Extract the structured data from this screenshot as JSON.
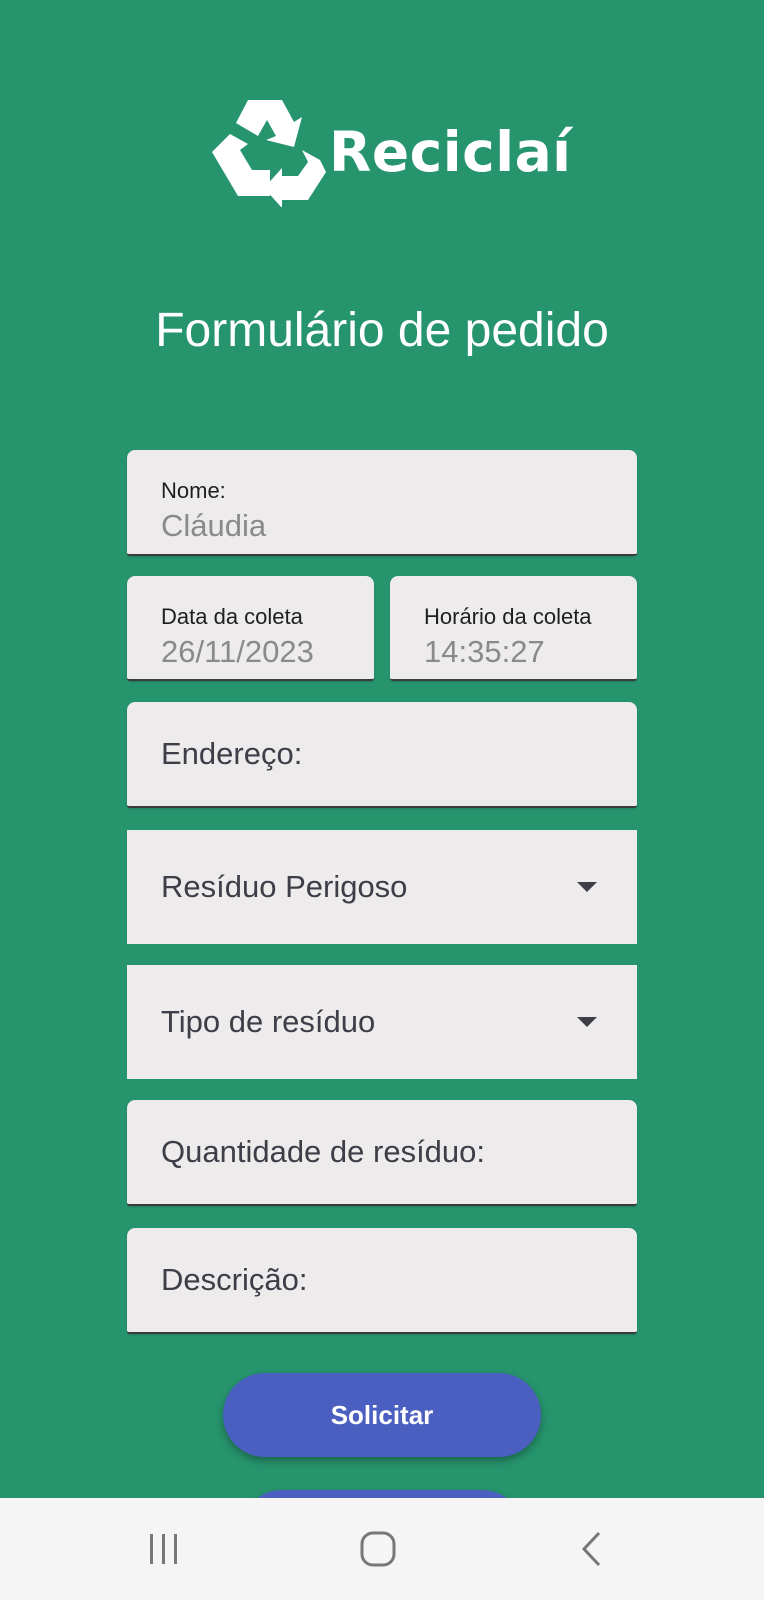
{
  "app": {
    "brand": "Reciclaí"
  },
  "form": {
    "title": "Formulário de pedido",
    "nome": {
      "label": "Nome:",
      "value": "Cláudia"
    },
    "data": {
      "label": "Data da coleta",
      "value": "26/11/2023"
    },
    "horario": {
      "label": "Horário da coleta",
      "value": "14:35:27"
    },
    "endereco": {
      "label": "Endereço:"
    },
    "residuo_perigoso": {
      "label": "Resíduo Perigoso"
    },
    "tipo_residuo": {
      "label": "Tipo de resíduo"
    },
    "quantidade": {
      "label": "Quantidade de resíduo:"
    },
    "descricao": {
      "label": "Descrição:"
    },
    "submit_label": "Solicitar"
  },
  "icons": {
    "logo": "recycle-icon",
    "dropdown": "chevron-down-icon",
    "nav_recents": "recents-icon",
    "nav_home": "home-icon",
    "nav_back": "back-icon"
  },
  "colors": {
    "background": "#26946d",
    "field": "#edebec",
    "button": "#4a5fc0",
    "navbar": "#f5f5f5"
  }
}
